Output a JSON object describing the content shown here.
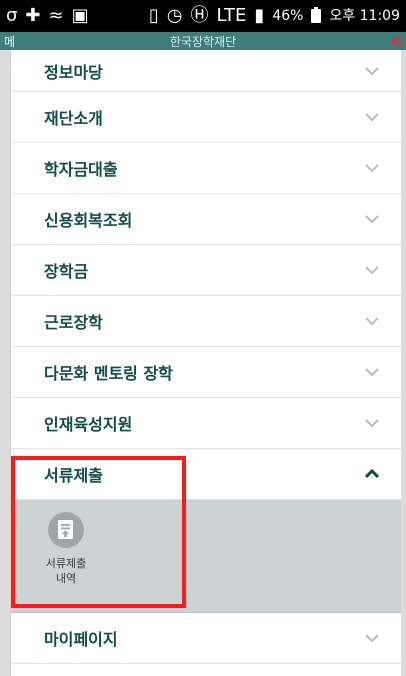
{
  "status_bar": {
    "left_icons": [
      "app-notification-icon",
      "dark-plus-icon",
      "wifi-like-icon",
      "image-icon"
    ],
    "right_icons": [
      "notification-icon",
      "clock-icon",
      "hd-icon",
      "lte-icon",
      "signal-icon"
    ],
    "battery_percent_text": "46%",
    "time_text": "오후 11:09"
  },
  "app_header": {
    "left_text": "메",
    "title": "한국장학재단",
    "right_text": "리"
  },
  "menu": {
    "items": [
      {
        "label": "정보마당",
        "expanded": false
      },
      {
        "label": "재단소개",
        "expanded": false
      },
      {
        "label": "학자금대출",
        "expanded": false
      },
      {
        "label": "신용회복조회",
        "expanded": false
      },
      {
        "label": "장학금",
        "expanded": false
      },
      {
        "label": "근로장학",
        "expanded": false
      },
      {
        "label": "다문화 멘토링 장학",
        "expanded": false
      },
      {
        "label": "인재육성지원",
        "expanded": false
      },
      {
        "label": "서류제출",
        "expanded": true
      },
      {
        "label": "마이페이지",
        "expanded": false
      }
    ],
    "expanded_sub": {
      "parent": "서류제출",
      "tiles": [
        {
          "icon": "document-upload-icon",
          "label": "서류제출\n내역"
        }
      ]
    }
  },
  "colors": {
    "header_teal": "#3f7f7b",
    "menu_text": "#134b48",
    "highlight_red": "#ff1a1a",
    "sub_bg": "#cdd2d4"
  }
}
